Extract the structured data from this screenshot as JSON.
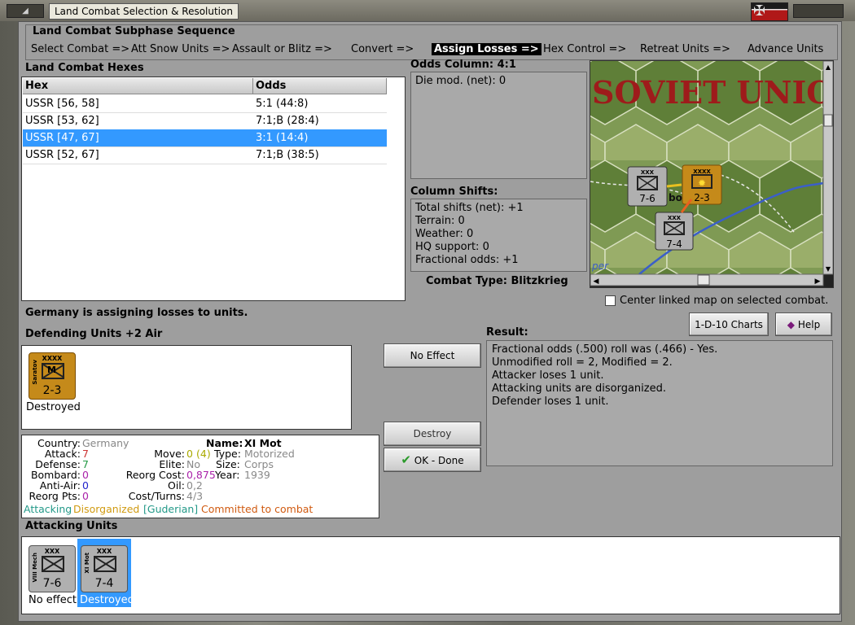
{
  "window": {
    "title": "Land Combat Selection & Resolution"
  },
  "sequence": {
    "title": "Land Combat Subphase Sequence",
    "steps": [
      "Select Combat =>",
      "Att Snow Units =>",
      "Assault or Blitz =>",
      "Convert =>",
      "Assign Losses =>",
      "Hex Control =>",
      "Retreat Units =>",
      "Advance Units"
    ],
    "active_index": 4
  },
  "hexes": {
    "title": "Land Combat Hexes",
    "columns": [
      "Hex",
      "Odds"
    ],
    "rows": [
      {
        "hex": "USSR [56, 58]",
        "odds": "5:1 (44:8)"
      },
      {
        "hex": "USSR [53, 62]",
        "odds": "7:1;B (28:4)"
      },
      {
        "hex": "USSR [47, 67]",
        "odds": "3:1 (14:4)"
      },
      {
        "hex": "USSR [52, 67]",
        "odds": "7:1;B (38:5)"
      }
    ],
    "selected_index": 2
  },
  "odds": {
    "title": "Odds Column: 4:1",
    "die_mod": "Die mod. (net): 0"
  },
  "shifts": {
    "title": "Column Shifts:",
    "lines": [
      "Total shifts (net): +1",
      "Terrain: 0",
      "Weather: 0",
      "HQ support: 0",
      "Fractional odds: +1"
    ]
  },
  "combat_type": "Combat Type:  Blitzkrieg",
  "map": {
    "label": "SOVIET UNIO",
    "units": [
      {
        "name": "VIII Mech",
        "size": "XXX",
        "value": "7-6"
      },
      {
        "name": "Saratov",
        "size": "XXXX",
        "value": "2-3"
      },
      {
        "name": "XI Mot",
        "size": "XXX",
        "value": "7-4"
      }
    ],
    "fragment": "bo",
    "fragment2": "per"
  },
  "center_map_label": "Center linked map on selected combat.",
  "buttons": {
    "charts": "1-D-10 Charts",
    "help": "Help",
    "no_effect": "No Effect",
    "destroy": "Destroy",
    "ok_done": "OK - Done"
  },
  "status": "Germany is assigning losses to units.",
  "defending": {
    "title": "Defending Units +2 Air",
    "unit": {
      "name": "Saratov",
      "size": "XXXX",
      "letter": "M",
      "value": "2-3",
      "state": "Destroyed"
    }
  },
  "result": {
    "title": "Result:",
    "lines": [
      "Fractional odds (.500) roll was (.466)  - Yes.",
      "Unmodified roll = 2, Modified = 2.",
      "Attacker loses 1 unit.",
      "Attacking units are disorganized.",
      "Defender loses 1 unit."
    ]
  },
  "unit_info": {
    "country_label": "Country:",
    "country": "Germany",
    "name_label": "Name:",
    "name": "XI Mot",
    "attack_label": "Attack:",
    "attack": "7",
    "move_label": "Move:",
    "move": "0",
    "move_extra": "(4)",
    "type_label": "Type:",
    "type": "Motorized",
    "defense_label": "Defense:",
    "defense": "7",
    "elite_label": "Elite:",
    "elite": "No",
    "size_label": "Size:",
    "size": "Corps",
    "bombard_label": "Bombard:",
    "bombard": "0",
    "reorg_label": "Reorg Cost:",
    "reorg": "0,875",
    "year_label": "Year:",
    "year": "1939",
    "antiair_label": "Anti-Air:",
    "antiair": "0",
    "oil_label": "Oil:",
    "oil": "0,2",
    "reorgpts_label": "Reorg Pts:",
    "reorgpts": "0",
    "cost_label": "Cost/Turns:",
    "cost": "4/3",
    "flags": [
      "Attacking",
      "Disorganized",
      "[Guderian]",
      "Committed to combat"
    ]
  },
  "attacking": {
    "title": "Attacking Units",
    "units": [
      {
        "name": "VIII Mech",
        "size": "XXX",
        "value": "7-6",
        "state": "No effect"
      },
      {
        "name": "XI Mot",
        "size": "XXX",
        "value": "7-4",
        "state": "Destroyed"
      }
    ]
  },
  "colors": {
    "selection": "#3399ff",
    "german_orange": "#c58a1a",
    "attack_red": "#cc3333",
    "defense_green": "#229944",
    "bombard_purple": "#aa22aa",
    "antiair_blue": "#2222cc"
  }
}
